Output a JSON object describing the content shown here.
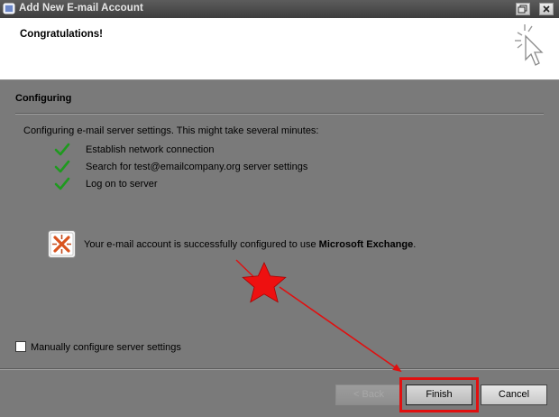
{
  "window": {
    "title": "Add New E-mail Account",
    "controls": [
      "restore-icon",
      "close-icon"
    ]
  },
  "header": {
    "title": "Congratulations!",
    "icon": "wizard-cursor-icon"
  },
  "section": {
    "title": "Configuring",
    "message": "Configuring e-mail server settings. This might take several minutes:",
    "steps": [
      {
        "label": "Establish network connection",
        "status": "done"
      },
      {
        "label": "Search for test@emailcompany.org server settings",
        "status": "done"
      },
      {
        "label": "Log on to server",
        "status": "done"
      }
    ]
  },
  "result": {
    "text_prefix": "Your e-mail account is successfully configured to use ",
    "server_type": "Microsoft Exchange",
    "text_suffix": ".",
    "icon": "exchange-icon"
  },
  "options": {
    "manual_config_label": "Manually configure server settings",
    "manual_config_checked": false
  },
  "buttons": {
    "back": "< Back",
    "back_enabled": false,
    "finish": "Finish",
    "cancel": "Cancel"
  },
  "annotation": {
    "marker": "star-icon",
    "target": "finish-button",
    "color": "#e01010"
  },
  "colors": {
    "check": "#1e9a1e",
    "dialog_bg": "#7a7a7a",
    "highlight": "#e01010"
  }
}
